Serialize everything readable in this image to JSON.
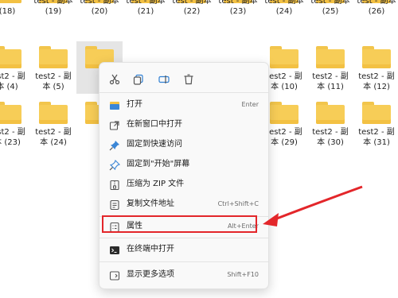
{
  "explorer": {
    "rows": [
      [
        {
          "l1": "(18)",
          "l2": ""
        },
        {
          "l1": "test - 副本",
          "l2": "(19)"
        },
        {
          "l1": "test - 副本",
          "l2": "(20)"
        },
        {
          "l1": "test - 副本",
          "l2": "(21)"
        },
        {
          "l1": "test - 副本",
          "l2": "(22)"
        },
        {
          "l1": "test - 副本",
          "l2": "(23)"
        },
        {
          "l1": "test - 副本",
          "l2": "(24)"
        },
        {
          "l1": "test - 副本",
          "l2": "(25)"
        },
        {
          "l1": "test - 副本",
          "l2": "(26)"
        }
      ],
      [
        {
          "l1": "test2 - 副",
          "l2": "本 (4)"
        },
        {
          "l1": "test2 - 副",
          "l2": "本 (5)"
        },
        {
          "l1": "",
          "l2": ""
        },
        {
          "l1": "",
          "l2": ""
        },
        {
          "l1": "",
          "l2": ""
        },
        {
          "l1": "",
          "l2": ""
        },
        {
          "l1": "test2 - 副",
          "l2": "本 (10)"
        },
        {
          "l1": "test2 - 副",
          "l2": "本 (11)"
        },
        {
          "l1": "test2 - 副",
          "l2": "本 (12)"
        }
      ],
      [
        {
          "l1": "test2 - 副",
          "l2": "本 (23)"
        },
        {
          "l1": "test2 - 副",
          "l2": "本 (24)"
        },
        {
          "l1": "",
          "l2": ""
        },
        {
          "l1": "",
          "l2": ""
        },
        {
          "l1": "",
          "l2": ""
        },
        {
          "l1": "",
          "l2": ""
        },
        {
          "l1": "test2 - 副",
          "l2": "本 (29)"
        },
        {
          "l1": "test2 - 副",
          "l2": "本 (30)"
        },
        {
          "l1": "test2 - 副",
          "l2": "本 (31)"
        }
      ]
    ]
  },
  "menu": {
    "quick_actions": [
      "cut-icon",
      "copy-icon",
      "rename-icon",
      "delete-icon"
    ],
    "items": [
      {
        "label": "打开",
        "shortcut": "Enter",
        "icon": "open-icon"
      },
      {
        "label": "在新窗口中打开",
        "shortcut": "",
        "icon": "new-window-icon"
      },
      {
        "label": "固定到快速访问",
        "shortcut": "",
        "icon": "pin-icon"
      },
      {
        "label": "固定到\"开始\"屏幕",
        "shortcut": "",
        "icon": "pin-start-icon"
      },
      {
        "label": "压缩为 ZIP 文件",
        "shortcut": "",
        "icon": "zip-icon"
      },
      {
        "label": "复制文件地址",
        "shortcut": "Ctrl+Shift+C",
        "icon": "copy-path-icon"
      },
      {
        "label": "属性",
        "shortcut": "Alt+Enter",
        "icon": "properties-icon"
      },
      {
        "label": "在终端中打开",
        "shortcut": "",
        "icon": "terminal-icon"
      },
      {
        "label": "显示更多选项",
        "shortcut": "Shift+F10",
        "icon": "more-options-icon"
      }
    ]
  },
  "colors": {
    "highlight": "#e3262a",
    "folder": "#f7cd57"
  }
}
